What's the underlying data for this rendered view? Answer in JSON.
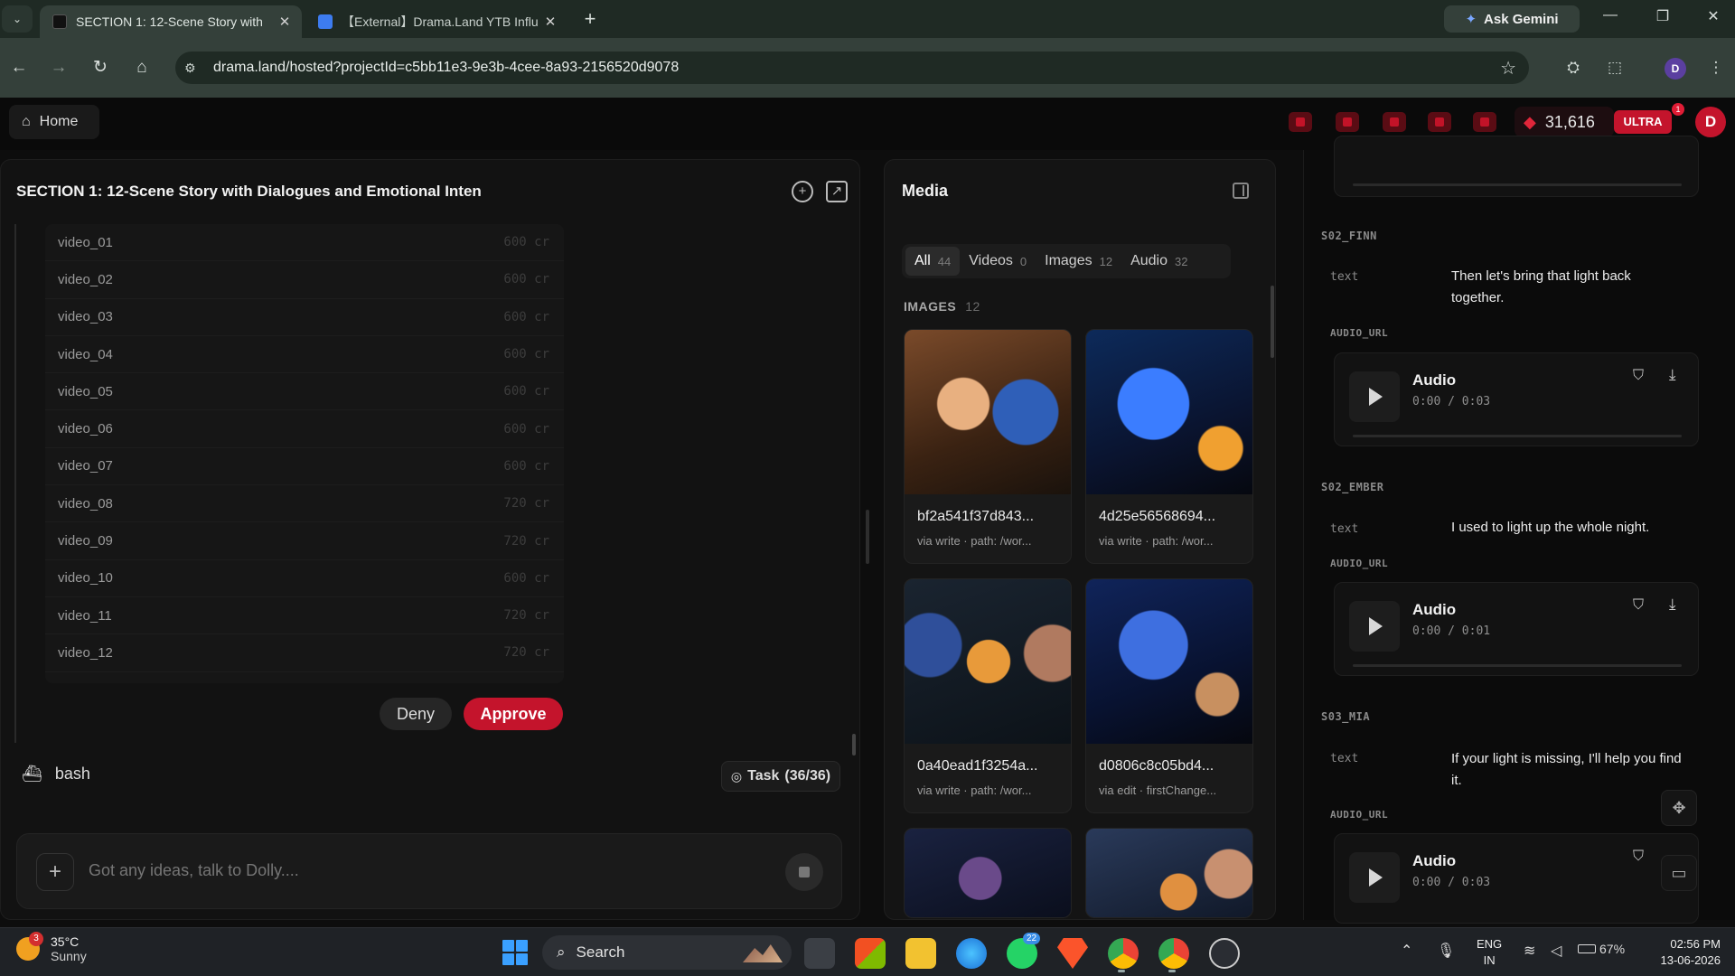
{
  "browser": {
    "tabs": [
      {
        "title": "SECTION 1: 12-Scene Story with",
        "active": true
      },
      {
        "title": "【External】Drama.Land YTB Influ",
        "active": false
      }
    ],
    "ask_gemini": "Ask Gemini",
    "url": "drama.land/hosted?projectId=c5bb11e3-9e3b-4cee-8a93-2156520d9078",
    "profile_letter": "D"
  },
  "app_header": {
    "home_label": "Home",
    "credits": "31,616",
    "plan_badge": "ULTRA",
    "notification_count": "1",
    "avatar_letter": "D"
  },
  "left_panel": {
    "title": "SECTION 1: 12-Scene Story with Dialogues and Emotional Inten",
    "videos": [
      {
        "name": "video_01",
        "cost": "600 cr"
      },
      {
        "name": "video_02",
        "cost": "600 cr"
      },
      {
        "name": "video_03",
        "cost": "600 cr"
      },
      {
        "name": "video_04",
        "cost": "600 cr"
      },
      {
        "name": "video_05",
        "cost": "600 cr"
      },
      {
        "name": "video_06",
        "cost": "600 cr"
      },
      {
        "name": "video_07",
        "cost": "600 cr"
      },
      {
        "name": "video_08",
        "cost": "720 cr"
      },
      {
        "name": "video_09",
        "cost": "720 cr"
      },
      {
        "name": "video_10",
        "cost": "600 cr"
      },
      {
        "name": "video_11",
        "cost": "720 cr"
      },
      {
        "name": "video_12",
        "cost": "720 cr"
      }
    ],
    "deny_label": "Deny",
    "approve_label": "Approve",
    "tool_name": "bash",
    "task_label": "Task",
    "task_progress": "(36/36)",
    "chat_placeholder": "Got any ideas, talk to Dolly...."
  },
  "media_panel": {
    "title": "Media",
    "filters": [
      {
        "label": "All",
        "count": "44"
      },
      {
        "label": "Videos",
        "count": "0"
      },
      {
        "label": "Images",
        "count": "12"
      },
      {
        "label": "Audio",
        "count": "32"
      }
    ],
    "section_label": "IMAGES",
    "section_count": "12",
    "cards": [
      {
        "name": "bf2a541f37d843...",
        "sub": "via write · path: /wor..."
      },
      {
        "name": "4d25e56568694...",
        "sub": "via write · path: /wor..."
      },
      {
        "name": "0a40ead1f3254a...",
        "sub": "via write · path: /wor..."
      },
      {
        "name": "d0806c8c05bd4...",
        "sub": "via edit · firstChange..."
      }
    ]
  },
  "right_panel": {
    "entries": [
      {
        "section": "S02_FINN",
        "key": "text",
        "text": "Then let's bring that light back together.",
        "audio_key": "AUDIO_URL",
        "audio_title": "Audio",
        "audio_time": "0:00 / 0:03"
      },
      {
        "section": "S02_EMBER",
        "key": "text",
        "text": "I used to light up the whole night.",
        "audio_key": "AUDIO_URL",
        "audio_title": "Audio",
        "audio_time": "0:00 / 0:01"
      },
      {
        "section": "S03_MIA",
        "key": "text",
        "text": "If your light is missing, I'll help you find it.",
        "audio_key": "AUDIO_URL",
        "audio_title": "Audio",
        "audio_time": "0:00 / 0:03"
      }
    ]
  },
  "taskbar": {
    "temperature": "35°C",
    "weather": "Sunny",
    "weather_badge": "3",
    "search_label": "Search",
    "whatsapp_badge": "22",
    "lang_top": "ENG",
    "lang_bottom": "IN",
    "battery": "67%",
    "time": "02:56 PM",
    "date": "13-06-2026"
  }
}
